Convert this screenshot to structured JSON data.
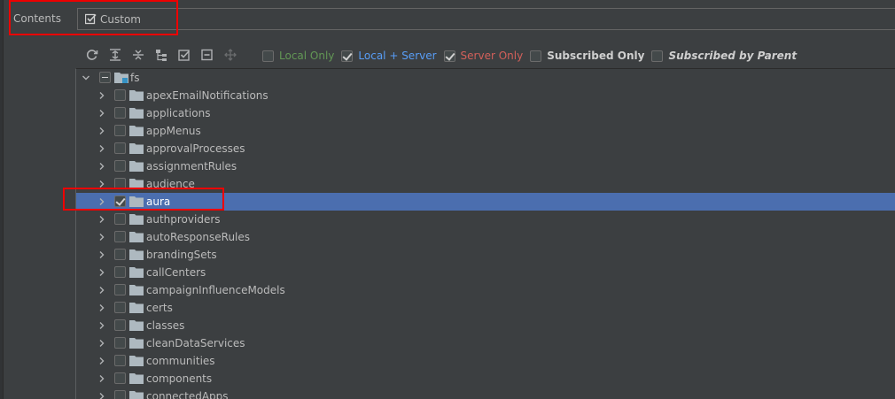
{
  "contents": {
    "label": "Contents",
    "selected_value": "Custom"
  },
  "toolbar": {
    "buttons": [
      {
        "name": "refresh-icon"
      },
      {
        "name": "expand-all-icon"
      },
      {
        "name": "collapse-all-icon"
      },
      {
        "name": "tree-hierarchy-icon"
      },
      {
        "name": "check-all-icon"
      },
      {
        "name": "uncheck-all-icon"
      },
      {
        "name": "move-icon"
      }
    ]
  },
  "filters": [
    {
      "label": "Local Only",
      "checked": false,
      "color": "#629755"
    },
    {
      "label": "Local + Server",
      "checked": true,
      "color": "#589df6"
    },
    {
      "label": "Server Only",
      "checked": true,
      "color": "#d2605a"
    },
    {
      "label": "Subscribed Only",
      "checked": false,
      "color": "#cfcfcf"
    },
    {
      "label": "Subscribed by Parent",
      "checked": false,
      "color": "#cfcfcf"
    }
  ],
  "tree": {
    "root": {
      "label": "fs",
      "state": "partial",
      "expanded": true
    },
    "items": [
      {
        "label": "apexEmailNotifications",
        "checked": false
      },
      {
        "label": "applications",
        "checked": false
      },
      {
        "label": "appMenus",
        "checked": false
      },
      {
        "label": "approvalProcesses",
        "checked": false
      },
      {
        "label": "assignmentRules",
        "checked": false
      },
      {
        "label": "audience",
        "checked": false
      },
      {
        "label": "aura",
        "checked": true,
        "selected": true
      },
      {
        "label": "authproviders",
        "checked": false
      },
      {
        "label": "autoResponseRules",
        "checked": false
      },
      {
        "label": "brandingSets",
        "checked": false
      },
      {
        "label": "callCenters",
        "checked": false
      },
      {
        "label": "campaignInfluenceModels",
        "checked": false
      },
      {
        "label": "certs",
        "checked": false
      },
      {
        "label": "classes",
        "checked": false
      },
      {
        "label": "cleanDataServices",
        "checked": false
      },
      {
        "label": "communities",
        "checked": false
      },
      {
        "label": "components",
        "checked": false
      },
      {
        "label": "connectedApps",
        "checked": false
      }
    ]
  },
  "colors": {
    "selection": "#4b6eaf",
    "highlight_box": "#ee0000",
    "folder": "#aeb9c0"
  }
}
